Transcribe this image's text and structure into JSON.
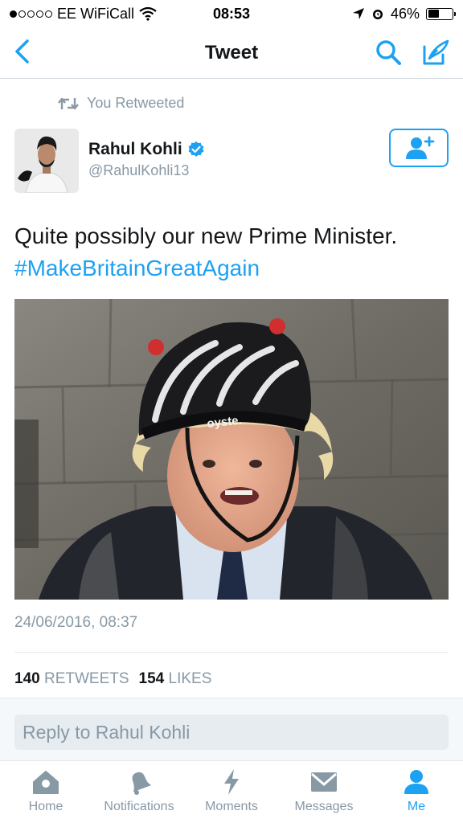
{
  "status_bar": {
    "carrier": "EE WiFiCall",
    "time": "08:53",
    "battery": "46%",
    "battery_level": 0.46,
    "signal_dots_filled": 1,
    "signal_dots_total": 5
  },
  "nav": {
    "title": "Tweet",
    "icons": [
      "back-chevron",
      "search",
      "compose"
    ]
  },
  "retweet_context": {
    "text": "You Retweeted"
  },
  "author": {
    "name": "Rahul Kohli",
    "handle": "@RahulKohli13",
    "verified": true
  },
  "tweet": {
    "text": "Quite possibly our new Prime Minister.",
    "hashtag": "#MakeBritainGreatAgain",
    "photo_helmet_text": "oyste.",
    "timestamp": "24/06/2016, 08:37"
  },
  "stats": {
    "retweets_count": "140",
    "retweets_label": "RETWEETS",
    "likes_count": "154",
    "likes_label": "LIKES"
  },
  "reply": {
    "placeholder": "Reply to Rahul Kohli"
  },
  "tabs": [
    {
      "label": "Home",
      "icon": "home",
      "active": false
    },
    {
      "label": "Notifications",
      "icon": "bell",
      "active": false
    },
    {
      "label": "Moments",
      "icon": "lightning",
      "active": false
    },
    {
      "label": "Messages",
      "icon": "envelope",
      "active": false
    },
    {
      "label": "Me",
      "icon": "person",
      "active": true
    }
  ],
  "colors": {
    "accent": "#1da1f2",
    "secondary_text": "#8899a6",
    "primary_text": "#14171a"
  }
}
